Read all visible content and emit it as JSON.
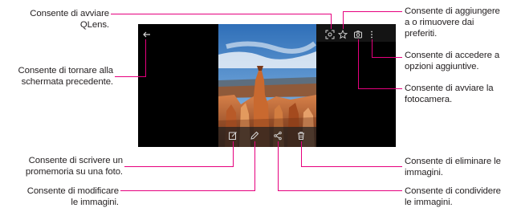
{
  "callouts": {
    "qlens": [
      "Consente di avviare",
      "QLens."
    ],
    "back": [
      "Consente di tornare alla",
      "schermata precedente."
    ],
    "memo": [
      "Consente di scrivere un",
      "promemoria su una foto."
    ],
    "edit": [
      "Consente di modificare",
      "le immagini."
    ],
    "favorite": [
      "Consente di aggiungere",
      "a o rimuovere dai",
      "preferiti."
    ],
    "more": [
      "Consente di accedere a",
      "opzioni aggiuntive."
    ],
    "camera": [
      "Consente di avviare la",
      "fotocamera."
    ],
    "delete": [
      "Consente di eliminare le",
      "immagini."
    ],
    "share": [
      "Consente di condividere",
      "le immagini."
    ]
  },
  "icons": {
    "back": "back-arrow-icon",
    "qlens": "qlens-icon",
    "favorite": "star-icon",
    "camera": "camera-icon",
    "more": "more-vertical-icon",
    "memo": "memo-icon",
    "edit": "pencil-icon",
    "share": "share-icon",
    "delete": "trash-icon"
  },
  "colors": {
    "leader": "#e6007e",
    "screen": "#000000",
    "icon": "#d8d8d8"
  }
}
